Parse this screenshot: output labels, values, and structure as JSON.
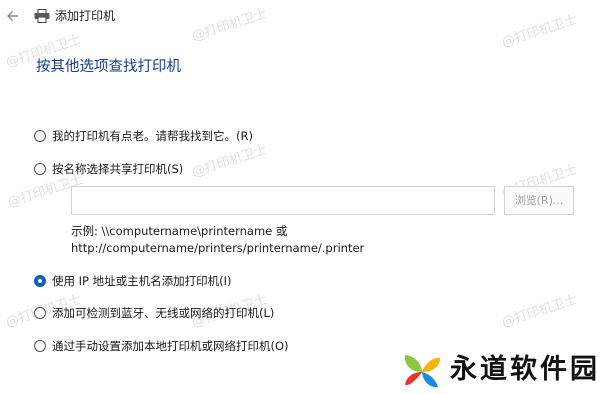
{
  "titlebar": {
    "back_icon": "back-arrow-icon",
    "printer_icon": "printer-icon",
    "title": "添加打印机"
  },
  "page": {
    "heading": "按其他选项查找打印机"
  },
  "options": [
    {
      "label": "我的打印机有点老。请帮我找到它。(R)",
      "checked": false
    },
    {
      "label": "按名称选择共享打印机(S)",
      "checked": false
    },
    {
      "label": "使用 IP 地址或主机名添加打印机(I)",
      "checked": true
    },
    {
      "label": "添加可检测到蓝牙、无线或网络的打印机(L)",
      "checked": false
    },
    {
      "label": "通过手动设置添加本地打印机或网络打印机(O)",
      "checked": false
    }
  ],
  "shared_printer": {
    "input_value": "",
    "browse_label": "浏览(R)...",
    "example_line1": "示例: \\\\computername\\printername 或",
    "example_line2": "http://computername/printers/printername/.printer"
  },
  "watermark": {
    "text": "@打印机卫士"
  },
  "brand": {
    "text": "永道软件园"
  },
  "colors": {
    "heading": "#1a3d8f",
    "accent": "#0a5fc2"
  }
}
